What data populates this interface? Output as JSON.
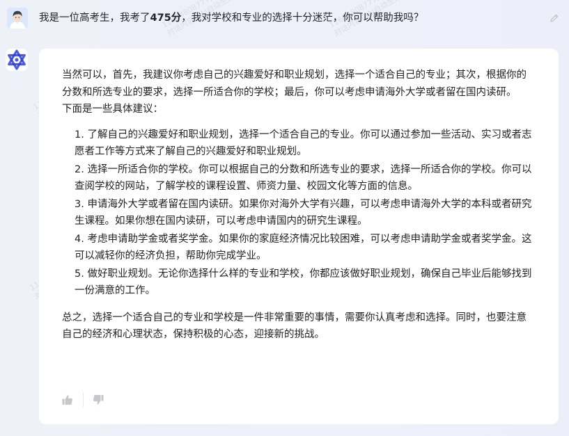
{
  "user": {
    "question_prefix": "我是一位高考生，我考了",
    "question_score": "475分",
    "question_suffix": "，我对学校和专业的选择十分迷茫，你可以帮助我吗？"
  },
  "answer": {
    "intro": "当然可以，首先，我建议你考虑自己的兴趣爱好和职业规划，选择一个适合自己的专业；其次，根据你的分数和所选专业的要求，选择一所适合你的学校；最后，你可以考虑申请海外大学或者留在国内读研。",
    "sub_heading": "下面是一些具体建议：",
    "items": [
      "1. 了解自己的兴趣爱好和职业规划，选择一个适合自己的专业。你可以通过参加一些活动、实习或者志愿者工作等方式来了解自己的兴趣爱好和职业规划。",
      "2. 选择一所适合你的学校。你可以根据自己的分数和所选专业的要求，选择一所适合你的学校。你可以查阅学校的网站，了解学校的课程设置、师资力量、校园文化等方面的信息。",
      "3. 申请海外大学或者留在国内读研。如果你对海外大学有兴趣，可以考虑申请海外大学的本科或者研究生课程。如果你想在国内读研，可以考虑申请国内的研究生课程。",
      "4. 考虑申请助学金或者奖学金。如果你的家庭经济情况比较困难，可以考虑申请助学金或者奖学金。这可以减轻你的经济负担，帮助你完成学业。",
      "5. 做好职业规划。无论你选择什么样的专业和学校，你都应该做好职业规划，确保自己毕业后能够找到一份满意的工作。"
    ],
    "summary": "总之，选择一个适合自己的专业和学校是一件非常重要的事情，需要你认真考虑和选择。同时，也要注意自己的经济和心理状态，保持积极的心态，迎接新的挑战。"
  },
  "watermark": {
    "id": "11684808777316",
    "text": "对话内容由AI自动生成"
  },
  "icons": {
    "user_avatar": "user-avatar-icon",
    "bot_logo": "bot-logo-icon",
    "edit": "pencil-icon",
    "thumbs_up": "thumbs-up-icon",
    "thumbs_down": "thumbs-down-icon"
  },
  "colors": {
    "background": "#eef0f8",
    "card": "#ffffff",
    "text": "#222222",
    "icon_gray": "#c4c7cc",
    "brand_blue": "#4a59e6"
  }
}
